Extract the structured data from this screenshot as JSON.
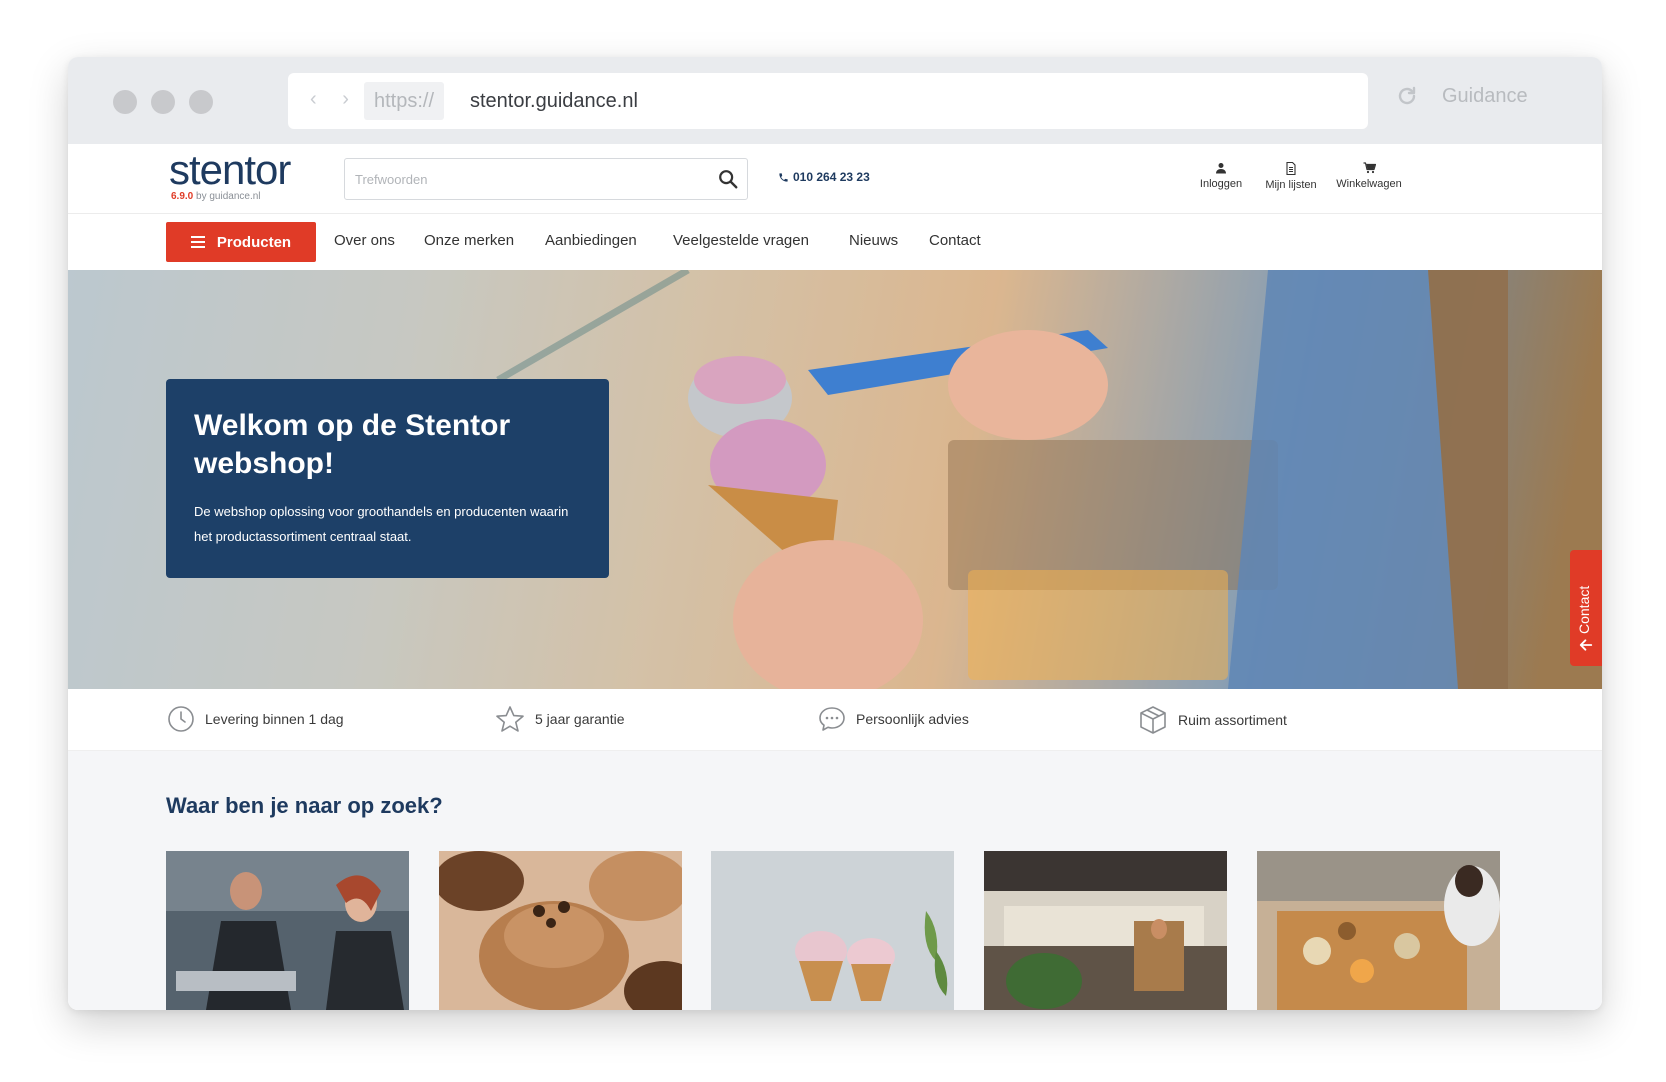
{
  "browser": {
    "protocol": "https://",
    "host": "stentor.guidance.nl",
    "brand": "Guidance",
    "nav_arrows": "‹ ›"
  },
  "header": {
    "logo_text": "stentor",
    "logo_version": "6.9.0",
    "logo_by": " by guidance.nl",
    "search_placeholder": "Trefwoorden",
    "phone": "010 264 23 23",
    "actions": [
      {
        "label": "Inloggen",
        "icon": "user-icon"
      },
      {
        "label": "Mijn lijsten",
        "icon": "list-icon"
      },
      {
        "label": "Winkelwagen",
        "icon": "cart-icon"
      }
    ]
  },
  "nav": {
    "products_label": "Producten",
    "items": [
      "Over ons",
      "Onze merken",
      "Aanbiedingen",
      "Veelgestelde vragen",
      "Nieuws",
      "Contact"
    ]
  },
  "hero": {
    "title": "Welkom op de Stentor webshop!",
    "subtitle": "De webshop oplossing voor groothandels en producenten waarin het productassortiment centraal staat.",
    "contact_tab": "Contact"
  },
  "usps": [
    {
      "label": "Levering binnen 1 dag",
      "icon": "clock-icon"
    },
    {
      "label": "5 jaar garantie",
      "icon": "star-icon"
    },
    {
      "label": "Persoonlijk advies",
      "icon": "chat-icon"
    },
    {
      "label": "Ruim assortiment",
      "icon": "box-icon"
    }
  ],
  "categories": {
    "title": "Waar ben je naar op zoek?",
    "tiles": [
      {
        "icon": "chefs-photo"
      },
      {
        "icon": "cupcakes-photo"
      },
      {
        "icon": "ice-cream-photo"
      },
      {
        "icon": "shop-interior-photo"
      },
      {
        "icon": "food-prep-photo"
      }
    ]
  },
  "colors": {
    "accent": "#e03b27",
    "brand_dark": "#1e3a5f",
    "hero_card": "#1d4068"
  }
}
